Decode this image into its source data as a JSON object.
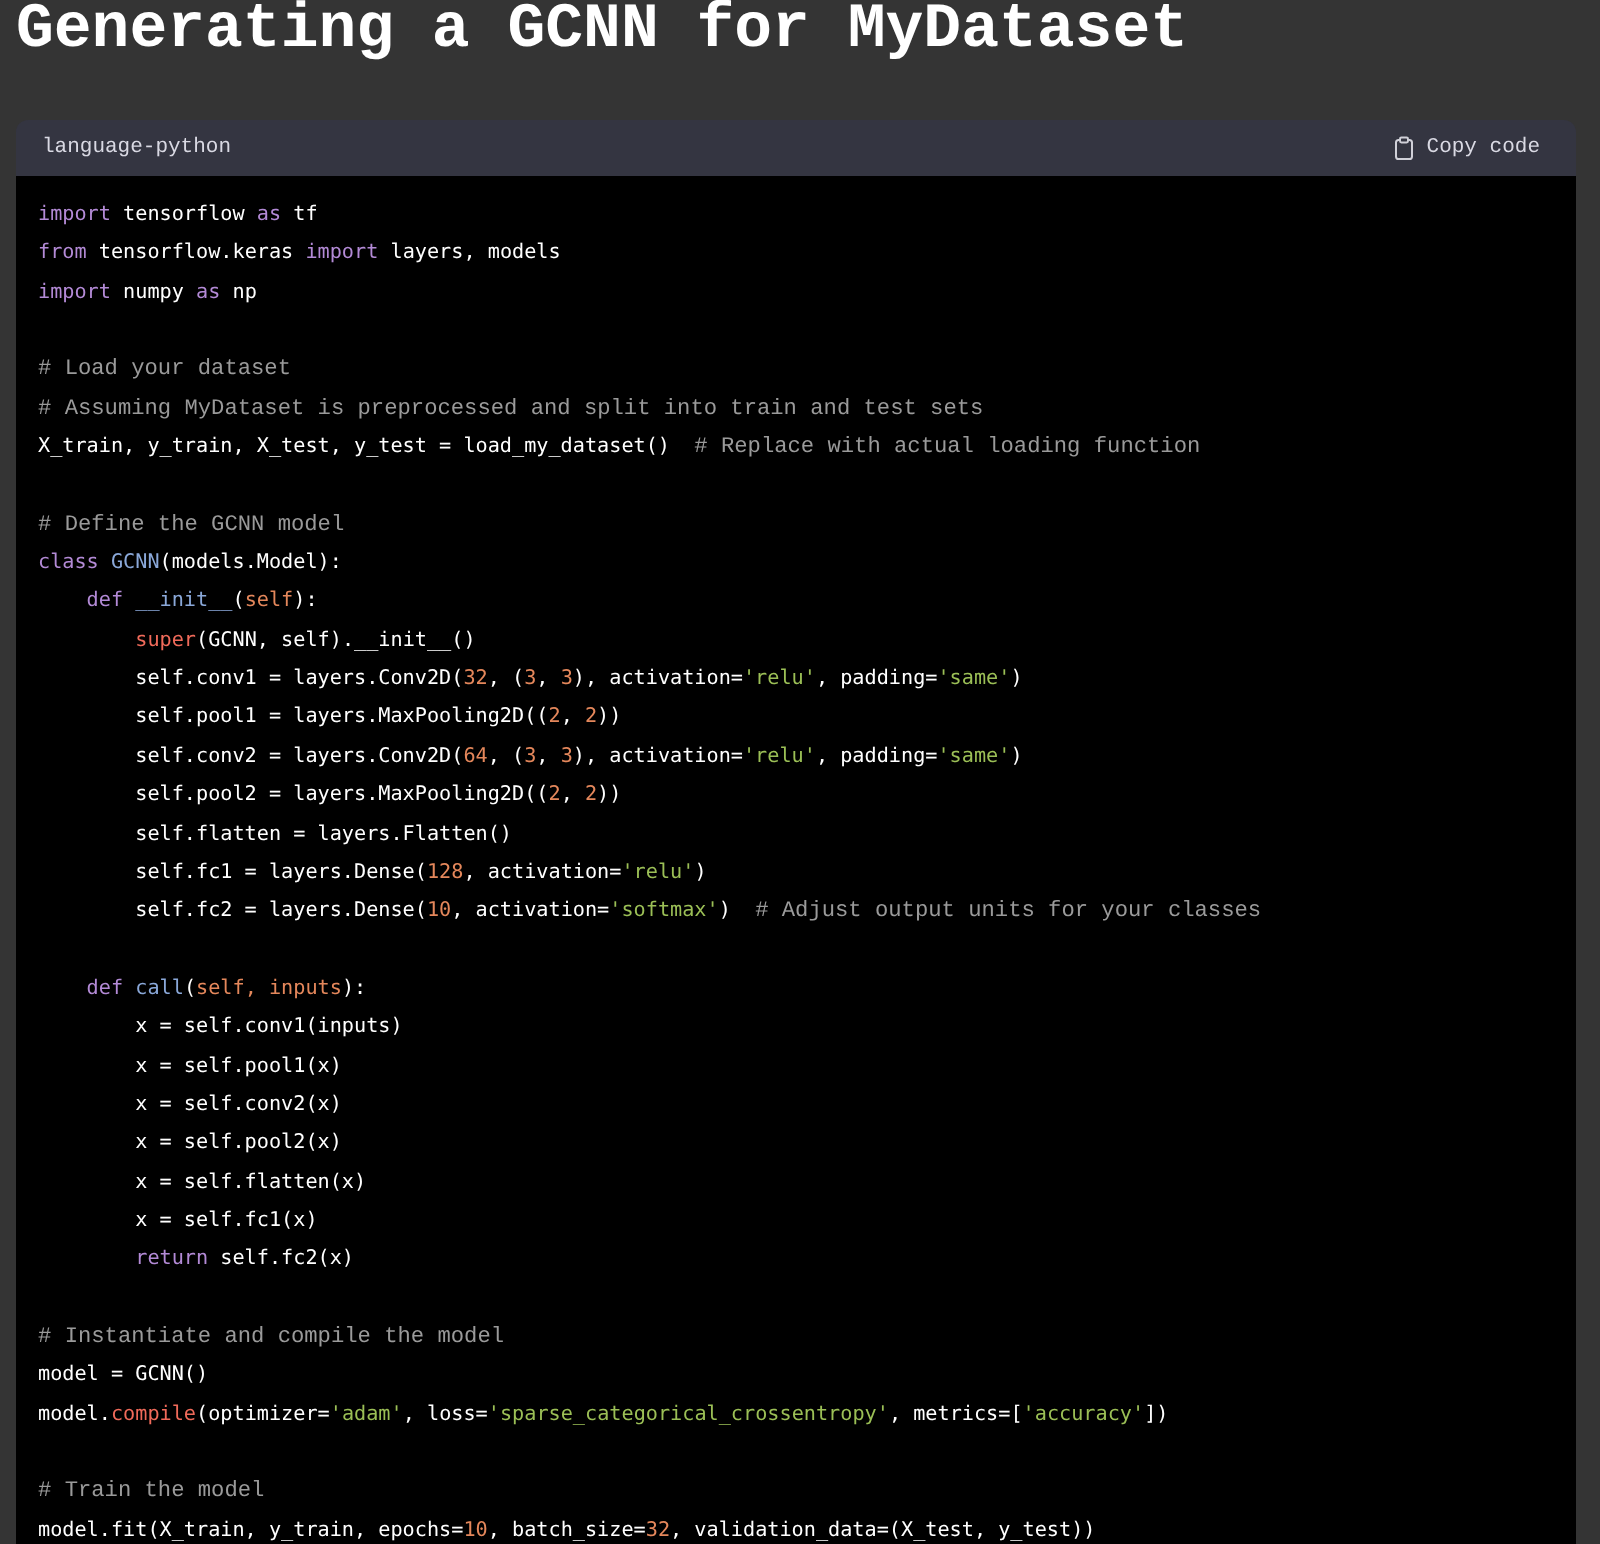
{
  "title": "Generating a GCNN for MyDataset",
  "code_block": {
    "language": "language-python",
    "copy_button": "Copy code",
    "lines": [
      {
        "kind": "code",
        "tokens": [
          {
            "t": "import",
            "kind": "kw"
          },
          {
            "t": " tensorflow ",
            "kind": "p"
          },
          {
            "t": "as",
            "kind": "kw"
          },
          {
            "t": " tf",
            "kind": "p"
          }
        ]
      },
      {
        "kind": "code",
        "tokens": [
          {
            "t": "from",
            "kind": "kw"
          },
          {
            "t": " tensorflow.keras ",
            "kind": "p"
          },
          {
            "t": "import",
            "kind": "kw"
          },
          {
            "t": " layers, models",
            "kind": "p"
          }
        ]
      },
      {
        "kind": "code",
        "tokens": [
          {
            "t": "import",
            "kind": "kw"
          },
          {
            "t": " numpy ",
            "kind": "p"
          },
          {
            "t": "as",
            "kind": "kw"
          },
          {
            "t": " np",
            "kind": "p"
          }
        ]
      },
      {
        "kind": "blank"
      },
      {
        "kind": "code",
        "tokens": [
          {
            "t": "# Load your dataset",
            "kind": "cm"
          }
        ]
      },
      {
        "kind": "code",
        "tokens": [
          {
            "t": "# Assuming MyDataset is preprocessed and split into train and test sets",
            "kind": "cm"
          }
        ]
      },
      {
        "kind": "code",
        "tokens": [
          {
            "t": "X_train, y_train, X_test, y_test = load_my_dataset()  ",
            "kind": "p"
          },
          {
            "t": "# Replace with actual loading function",
            "kind": "cm"
          }
        ]
      },
      {
        "kind": "blank"
      },
      {
        "kind": "code",
        "tokens": [
          {
            "t": "# Define the GCNN model",
            "kind": "cm"
          }
        ]
      },
      {
        "kind": "code",
        "tokens": [
          {
            "t": "class ",
            "kind": "kw"
          },
          {
            "t": "GCNN",
            "kind": "fn"
          },
          {
            "t": "(models.Model):",
            "kind": "p"
          }
        ]
      },
      {
        "kind": "code",
        "tokens": [
          {
            "t": "    def ",
            "kind": "kw"
          },
          {
            "t": "__init__",
            "kind": "fn"
          },
          {
            "t": "(",
            "kind": "p"
          },
          {
            "t": "self",
            "kind": "var"
          },
          {
            "t": "):",
            "kind": "p"
          }
        ]
      },
      {
        "kind": "code",
        "tokens": [
          {
            "t": "        super",
            "kind": "bi"
          },
          {
            "t": "(GCNN, self).__init__()",
            "kind": "p"
          }
        ]
      },
      {
        "kind": "code",
        "tokens": [
          {
            "t": "        self.conv1 = layers.Conv2D(",
            "kind": "p"
          },
          {
            "t": "32",
            "kind": "num"
          },
          {
            "t": ", (",
            "kind": "p"
          },
          {
            "t": "3",
            "kind": "num"
          },
          {
            "t": ", ",
            "kind": "p"
          },
          {
            "t": "3",
            "kind": "num"
          },
          {
            "t": "), activation=",
            "kind": "p"
          },
          {
            "t": "'relu'",
            "kind": "str"
          },
          {
            "t": ", padding=",
            "kind": "p"
          },
          {
            "t": "'same'",
            "kind": "str"
          },
          {
            "t": ")",
            "kind": "p"
          }
        ]
      },
      {
        "kind": "code",
        "tokens": [
          {
            "t": "        self.pool1 = layers.MaxPooling2D((",
            "kind": "p"
          },
          {
            "t": "2",
            "kind": "num"
          },
          {
            "t": ", ",
            "kind": "p"
          },
          {
            "t": "2",
            "kind": "num"
          },
          {
            "t": "))",
            "kind": "p"
          }
        ]
      },
      {
        "kind": "code",
        "tokens": [
          {
            "t": "        self.conv2 = layers.Conv2D(",
            "kind": "p"
          },
          {
            "t": "64",
            "kind": "num"
          },
          {
            "t": ", (",
            "kind": "p"
          },
          {
            "t": "3",
            "kind": "num"
          },
          {
            "t": ", ",
            "kind": "p"
          },
          {
            "t": "3",
            "kind": "num"
          },
          {
            "t": "), activation=",
            "kind": "p"
          },
          {
            "t": "'relu'",
            "kind": "str"
          },
          {
            "t": ", padding=",
            "kind": "p"
          },
          {
            "t": "'same'",
            "kind": "str"
          },
          {
            "t": ")",
            "kind": "p"
          }
        ]
      },
      {
        "kind": "code",
        "tokens": [
          {
            "t": "        self.pool2 = layers.MaxPooling2D((",
            "kind": "p"
          },
          {
            "t": "2",
            "kind": "num"
          },
          {
            "t": ", ",
            "kind": "p"
          },
          {
            "t": "2",
            "kind": "num"
          },
          {
            "t": "))",
            "kind": "p"
          }
        ]
      },
      {
        "kind": "code",
        "tokens": [
          {
            "t": "        self.flatten = layers.Flatten()",
            "kind": "p"
          }
        ]
      },
      {
        "kind": "code",
        "tokens": [
          {
            "t": "        self.fc1 = layers.Dense(",
            "kind": "p"
          },
          {
            "t": "128",
            "kind": "num"
          },
          {
            "t": ", activation=",
            "kind": "p"
          },
          {
            "t": "'relu'",
            "kind": "str"
          },
          {
            "t": ")",
            "kind": "p"
          }
        ]
      },
      {
        "kind": "code",
        "tokens": [
          {
            "t": "        self.fc2 = layers.Dense(",
            "kind": "p"
          },
          {
            "t": "10",
            "kind": "num"
          },
          {
            "t": ", activation=",
            "kind": "p"
          },
          {
            "t": "'softmax'",
            "kind": "str"
          },
          {
            "t": ")  ",
            "kind": "p"
          },
          {
            "t": "# Adjust output units for your classes",
            "kind": "cm"
          }
        ]
      },
      {
        "kind": "blank"
      },
      {
        "kind": "code",
        "tokens": [
          {
            "t": "    def ",
            "kind": "kw"
          },
          {
            "t": "call",
            "kind": "fn"
          },
          {
            "t": "(",
            "kind": "p"
          },
          {
            "t": "self, inputs",
            "kind": "var"
          },
          {
            "t": "):",
            "kind": "p"
          }
        ]
      },
      {
        "kind": "code",
        "tokens": [
          {
            "t": "        x = self.conv1(inputs)",
            "kind": "p"
          }
        ]
      },
      {
        "kind": "code",
        "tokens": [
          {
            "t": "        x = self.pool1(x)",
            "kind": "p"
          }
        ]
      },
      {
        "kind": "code",
        "tokens": [
          {
            "t": "        x = self.conv2(x)",
            "kind": "p"
          }
        ]
      },
      {
        "kind": "code",
        "tokens": [
          {
            "t": "        x = self.pool2(x)",
            "kind": "p"
          }
        ]
      },
      {
        "kind": "code",
        "tokens": [
          {
            "t": "        x = self.flatten(x)",
            "kind": "p"
          }
        ]
      },
      {
        "kind": "code",
        "tokens": [
          {
            "t": "        x = self.fc1(x)",
            "kind": "p"
          }
        ]
      },
      {
        "kind": "code",
        "tokens": [
          {
            "t": "        return",
            "kind": "kw"
          },
          {
            "t": " self.fc2(x)",
            "kind": "p"
          }
        ]
      },
      {
        "kind": "blank"
      },
      {
        "kind": "code",
        "tokens": [
          {
            "t": "# Instantiate and compile the model",
            "kind": "cm"
          }
        ]
      },
      {
        "kind": "code",
        "tokens": [
          {
            "t": "model = GCNN()",
            "kind": "p"
          }
        ]
      },
      {
        "kind": "code",
        "tokens": [
          {
            "t": "model.",
            "kind": "p"
          },
          {
            "t": "compile",
            "kind": "bi"
          },
          {
            "t": "(optimizer=",
            "kind": "p"
          },
          {
            "t": "'adam'",
            "kind": "str"
          },
          {
            "t": ", loss=",
            "kind": "p"
          },
          {
            "t": "'sparse_categorical_crossentropy'",
            "kind": "str"
          },
          {
            "t": ", metrics=[",
            "kind": "p"
          },
          {
            "t": "'accuracy'",
            "kind": "str"
          },
          {
            "t": "])",
            "kind": "p"
          }
        ]
      },
      {
        "kind": "blank"
      },
      {
        "kind": "code",
        "tokens": [
          {
            "t": "# Train the model",
            "kind": "cm"
          }
        ]
      },
      {
        "kind": "code",
        "tokens": [
          {
            "t": "model.fit(X_train, y_train, epochs=",
            "kind": "p"
          },
          {
            "t": "10",
            "kind": "num"
          },
          {
            "t": ", batch_size=",
            "kind": "p"
          },
          {
            "t": "32",
            "kind": "num"
          },
          {
            "t": ", validation_data=(X_test, y_test))",
            "kind": "p"
          }
        ]
      }
    ]
  }
}
